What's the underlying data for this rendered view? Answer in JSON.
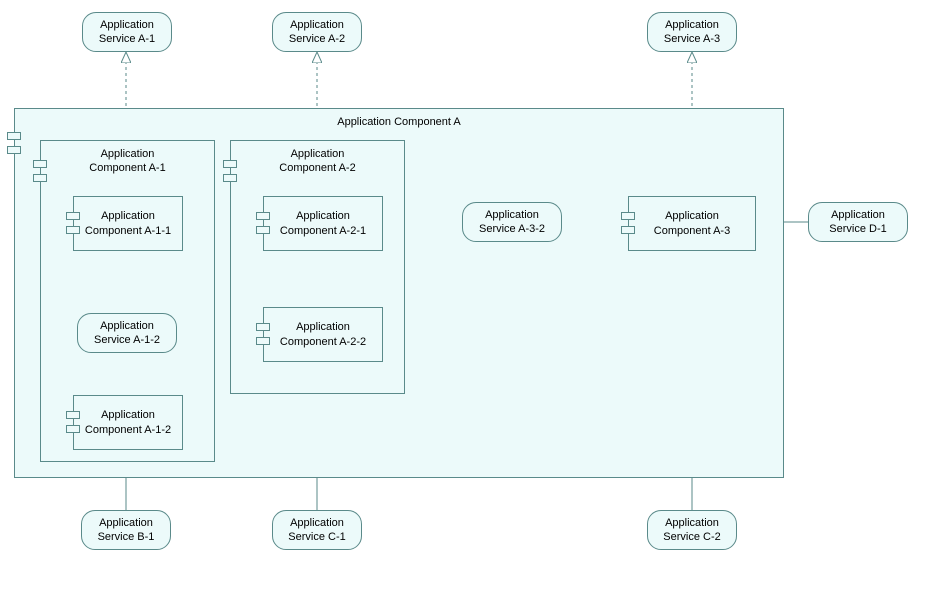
{
  "services": {
    "a1": "Application\nService A-1",
    "a2": "Application\nService A-2",
    "a3": "Application\nService A-3",
    "a12": "Application\nService A-1-2",
    "a32": "Application\nService A-3-2",
    "b1": "Application\nService B-1",
    "c1": "Application\nService C-1",
    "c2": "Application\nService C-2",
    "d1": "Application\nService D-1"
  },
  "components": {
    "a": "Application Component A",
    "a1": "Application\nComponent A-1",
    "a2": "Application\nComponent A-2",
    "a11": "Application\nComponent A-1-1",
    "a12": "Application\nComponent A-1-2",
    "a21": "Application\nComponent A-2-1",
    "a22": "Application\nComponent A-2-2",
    "a3": "Application\nComponent A-3"
  }
}
